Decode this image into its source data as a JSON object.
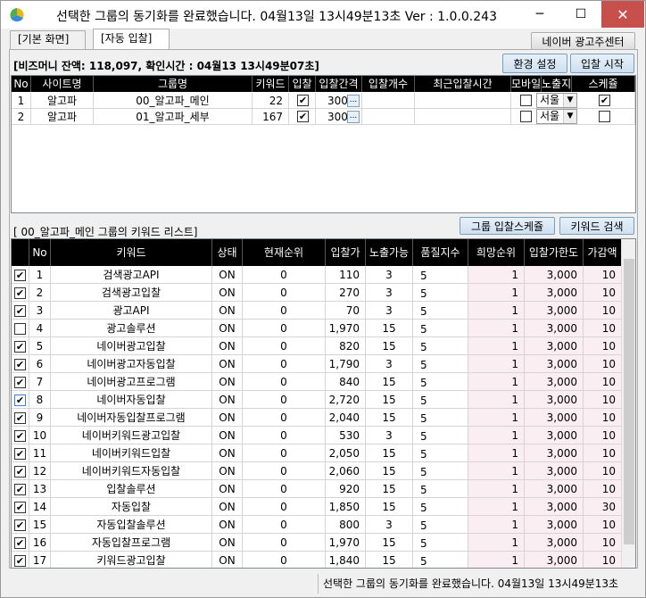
{
  "window": {
    "title": "선택한 그룹의 동기화를 완료했습니다. 04월13일 13시49분13초 Ver : 1.0.0.243",
    "min": "─",
    "max": "☐",
    "close": "✕"
  },
  "tabs": [
    {
      "label": "[기본 화면]"
    },
    {
      "label": "[자동 입찰]"
    }
  ],
  "buttons": {
    "naver_center": "네이버 광고주센터",
    "env_settings": "환경 설정",
    "bid_start": "입찰 시작",
    "group_bid_schedule": "그룹 입찰스케쥴",
    "keyword_search": "키워드 검색"
  },
  "balance_text": "[비즈머니 잔액: 118,097, 확인시간 : 04월13 13시49분07초]",
  "group_table": {
    "headers": [
      "No",
      "사이트명",
      "그룹명",
      "키워드",
      "입찰",
      "입찰간격",
      "입찰개수",
      "최근입찰시간",
      "모바일",
      "노출지역",
      "스케쥴"
    ],
    "rows": [
      {
        "no": "1",
        "site": "알고파",
        "group": "00_알고파_메인",
        "keywords": "22",
        "bid": true,
        "interval": "300",
        "count": "",
        "recent": "",
        "mobile": false,
        "region": "서울",
        "schedule": true
      },
      {
        "no": "2",
        "site": "알고파",
        "group": "01_알고파_세부",
        "keywords": "167",
        "bid": true,
        "interval": "300",
        "count": "",
        "recent": "",
        "mobile": false,
        "region": "서울",
        "schedule": false
      }
    ],
    "dots": "..."
  },
  "group_label": "[ 00_알고파_메인 그룹의 키워드 리스트]",
  "keyword_table": {
    "headers": [
      "No",
      "키워드",
      "상태",
      "현재순위",
      "입찰가",
      "노출가능",
      "품질지수",
      "희망순위",
      "입찰가한도",
      "가감액"
    ],
    "rows": [
      {
        "checked": true,
        "no": "1",
        "keyword": "검색광고API",
        "status": "ON",
        "rank": "0",
        "bid": "110",
        "exposure": "3",
        "quality": 5,
        "hope": "1",
        "limit": "3,000",
        "adj": "10"
      },
      {
        "checked": true,
        "no": "2",
        "keyword": "검색광고입찰",
        "status": "ON",
        "rank": "0",
        "bid": "270",
        "exposure": "3",
        "quality": 5,
        "hope": "1",
        "limit": "3,000",
        "adj": "10"
      },
      {
        "checked": true,
        "no": "3",
        "keyword": "광고API",
        "status": "ON",
        "rank": "0",
        "bid": "70",
        "exposure": "3",
        "quality": 5,
        "hope": "1",
        "limit": "3,000",
        "adj": "10"
      },
      {
        "checked": false,
        "no": "4",
        "keyword": "광고솔루션",
        "status": "ON",
        "rank": "0",
        "bid": "1,970",
        "exposure": "15",
        "quality": 5,
        "hope": "1",
        "limit": "3,000",
        "adj": "10"
      },
      {
        "checked": true,
        "no": "5",
        "keyword": "네이버광고입찰",
        "status": "ON",
        "rank": "0",
        "bid": "820",
        "exposure": "15",
        "quality": 5,
        "hope": "1",
        "limit": "3,000",
        "adj": "10"
      },
      {
        "checked": true,
        "no": "6",
        "keyword": "네이버광고자동입찰",
        "status": "ON",
        "rank": "0",
        "bid": "1,790",
        "exposure": "3",
        "quality": 5,
        "hope": "1",
        "limit": "3,000",
        "adj": "10"
      },
      {
        "checked": true,
        "no": "7",
        "keyword": "네이버광고프로그램",
        "status": "ON",
        "rank": "0",
        "bid": "840",
        "exposure": "15",
        "quality": 5,
        "hope": "1",
        "limit": "3,000",
        "adj": "10"
      },
      {
        "checked": true,
        "no": "8",
        "keyword": "네이버자동입찰",
        "status": "ON",
        "rank": "0",
        "bid": "2,720",
        "exposure": "15",
        "quality": 5,
        "hope": "1",
        "limit": "3,000",
        "adj": "10"
      },
      {
        "checked": true,
        "no": "9",
        "keyword": "네이버자동입찰프로그램",
        "status": "ON",
        "rank": "0",
        "bid": "2,040",
        "exposure": "15",
        "quality": 5,
        "hope": "1",
        "limit": "3,000",
        "adj": "10"
      },
      {
        "checked": true,
        "no": "10",
        "keyword": "네이버키워드광고입찰",
        "status": "ON",
        "rank": "0",
        "bid": "530",
        "exposure": "3",
        "quality": 5,
        "hope": "1",
        "limit": "3,000",
        "adj": "10"
      },
      {
        "checked": true,
        "no": "11",
        "keyword": "네이버키워드입찰",
        "status": "ON",
        "rank": "0",
        "bid": "2,050",
        "exposure": "15",
        "quality": 5,
        "hope": "1",
        "limit": "3,000",
        "adj": "10"
      },
      {
        "checked": true,
        "no": "12",
        "keyword": "네이버키워드자동입찰",
        "status": "ON",
        "rank": "0",
        "bid": "2,060",
        "exposure": "15",
        "quality": 5,
        "hope": "1",
        "limit": "3,000",
        "adj": "10"
      },
      {
        "checked": true,
        "no": "13",
        "keyword": "입찰솔루션",
        "status": "ON",
        "rank": "0",
        "bid": "920",
        "exposure": "15",
        "quality": 5,
        "hope": "1",
        "limit": "3,000",
        "adj": "10"
      },
      {
        "checked": true,
        "no": "14",
        "keyword": "자동입찰",
        "status": "ON",
        "rank": "0",
        "bid": "1,850",
        "exposure": "15",
        "quality": 5,
        "hope": "1",
        "limit": "3,000",
        "adj": "30"
      },
      {
        "checked": true,
        "no": "15",
        "keyword": "자동입찰솔루션",
        "status": "ON",
        "rank": "0",
        "bid": "800",
        "exposure": "3",
        "quality": 5,
        "hope": "1",
        "limit": "3,000",
        "adj": "10"
      },
      {
        "checked": true,
        "no": "16",
        "keyword": "자동입찰프로그램",
        "status": "ON",
        "rank": "0",
        "bid": "1,970",
        "exposure": "15",
        "quality": 5,
        "hope": "1",
        "limit": "3,000",
        "adj": "10"
      },
      {
        "checked": true,
        "no": "17",
        "keyword": "키워드광고입찰",
        "status": "ON",
        "rank": "0",
        "bid": "1,840",
        "exposure": "15",
        "quality": 5,
        "hope": "1",
        "limit": "3,000",
        "adj": "10"
      }
    ]
  },
  "status_text": "선택한 그룹의 동기화를 완료했습니다. 04월13일 13시49분13초",
  "colors": {
    "header_bg": "#000000",
    "quality_green": "#3cb14a",
    "hope_pink": "#fbeef2",
    "close_red": "#c7504d"
  }
}
